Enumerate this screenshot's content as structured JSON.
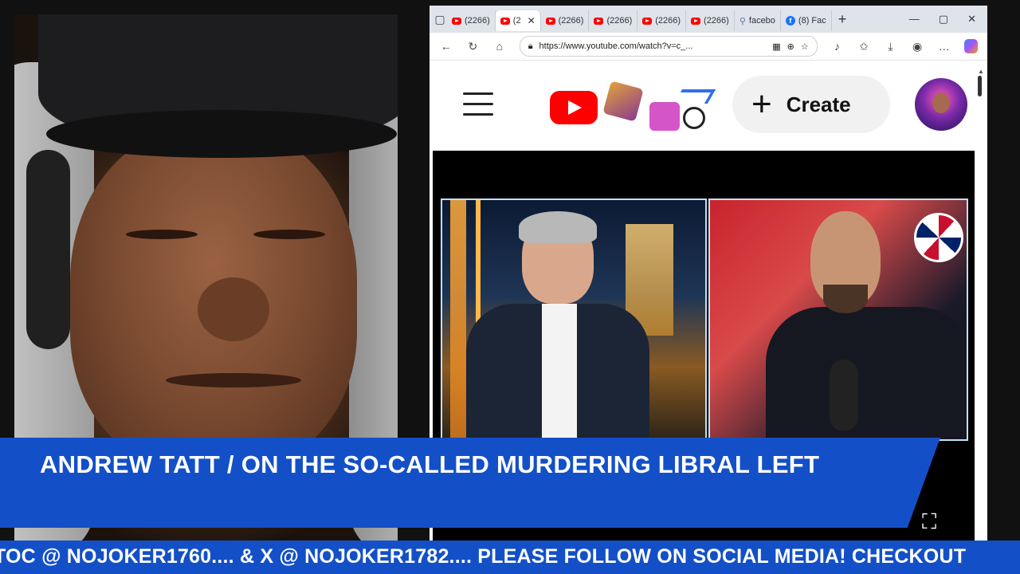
{
  "browser": {
    "tabs": [
      {
        "label": "(2266)",
        "icon": "youtube-icon",
        "active": false
      },
      {
        "label": "(2",
        "icon": "youtube-icon",
        "active": true
      },
      {
        "label": "(2266)",
        "icon": "youtube-icon",
        "active": false
      },
      {
        "label": "(2266)",
        "icon": "youtube-icon",
        "active": false
      },
      {
        "label": "(2266)",
        "icon": "youtube-icon",
        "active": false
      },
      {
        "label": "(2266)",
        "icon": "youtube-icon",
        "active": false
      },
      {
        "label": "facebo",
        "icon": "search-icon",
        "active": false
      },
      {
        "label": "(8) Fac",
        "icon": "facebook-icon",
        "active": false
      }
    ],
    "address": "https://www.youtube.com/watch?v=c_..."
  },
  "youtube": {
    "create_label": "Create"
  },
  "banner": {
    "text": "ANDREW TATT / ON THE SO-CALLED MURDERING LIBRAL LEFT"
  },
  "ticker": {
    "text": "TOC @ NOJOKER1760.... & X @ NOJOKER1782.... PLEASE FOLLOW ON SOCIAL MEDIA! CHECKOUT"
  },
  "colors": {
    "banner_blue": "#1350c8",
    "youtube_red": "#ff0000"
  }
}
